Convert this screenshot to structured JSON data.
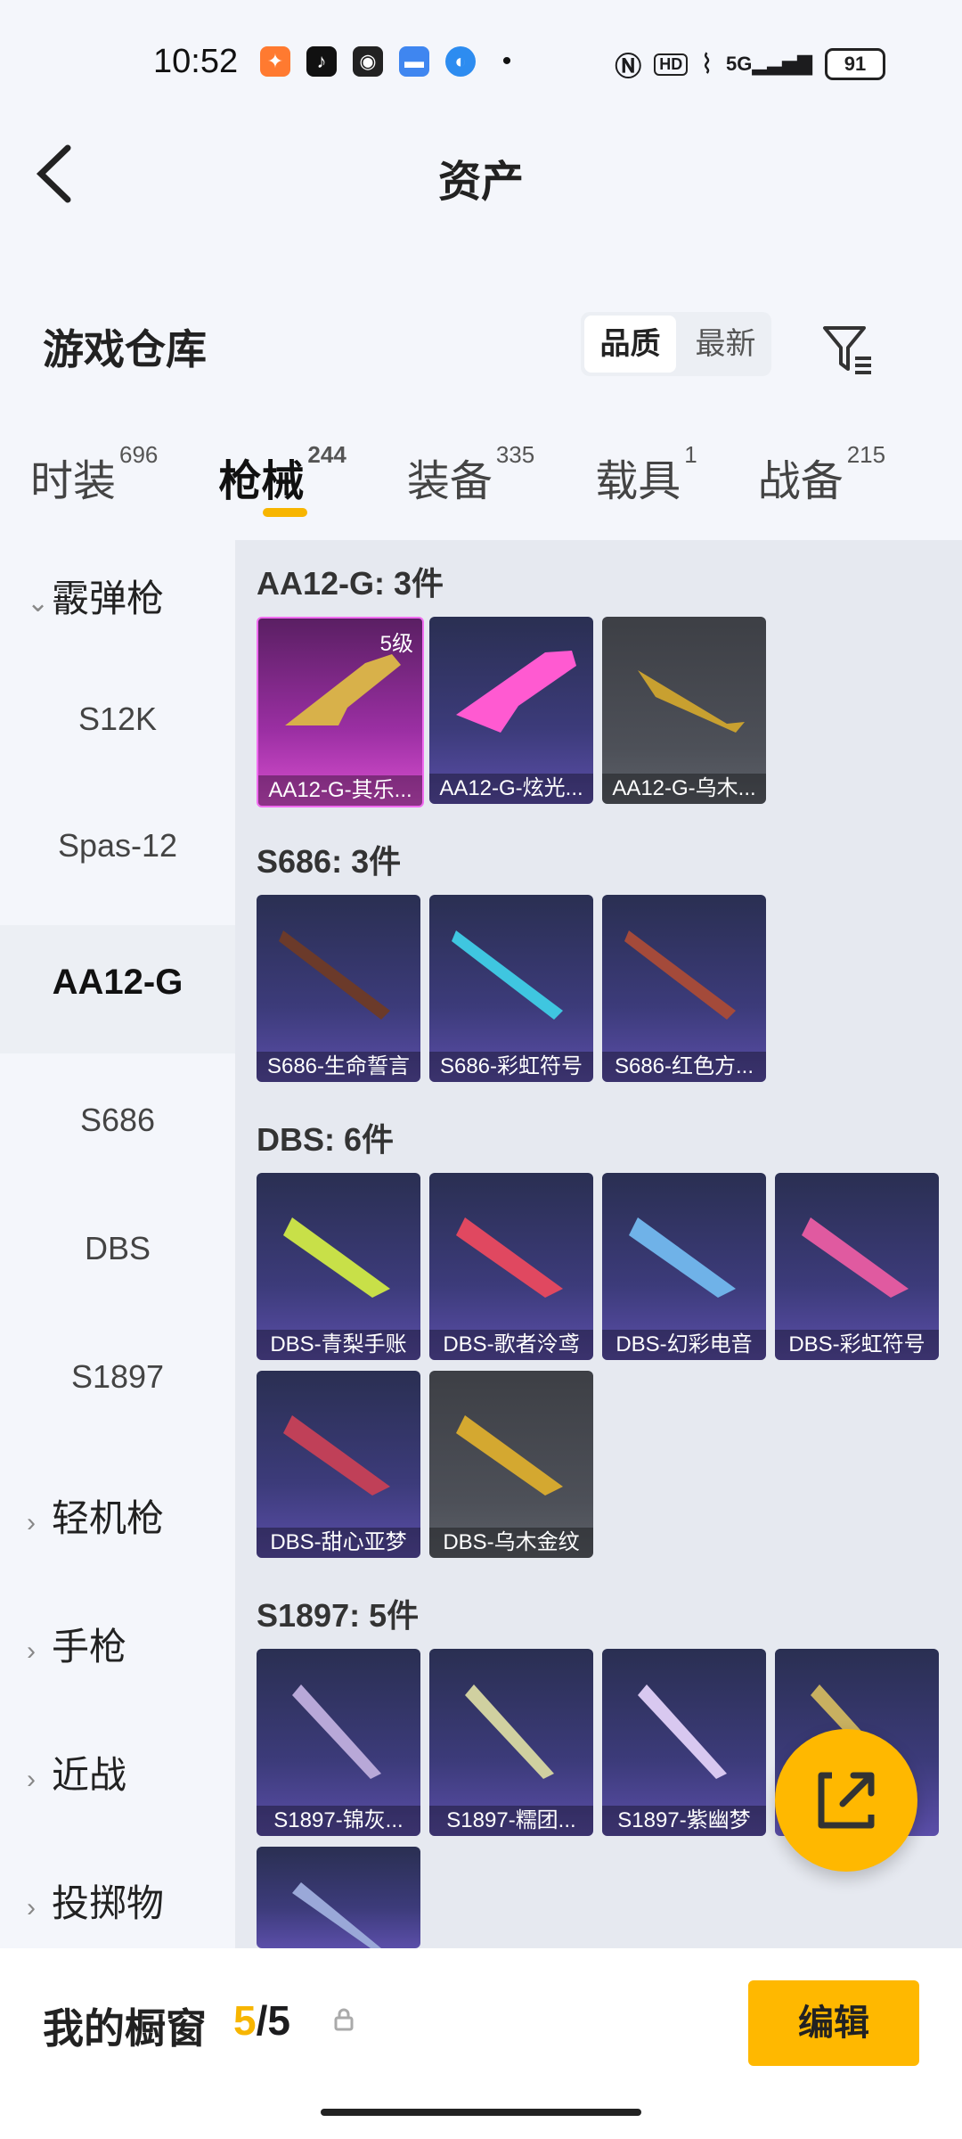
{
  "status_bar": {
    "time": "10:52",
    "app_icons": [
      "game-icon",
      "tiktok-icon",
      "wechat-icon",
      "wallet-icon",
      "browser-icon",
      "dot-icon"
    ],
    "right_icons": [
      "nfc-icon",
      "hd-icon",
      "wifi-icon",
      "5g-signal-icon"
    ],
    "hd_label": "HD",
    "network_label": "5G",
    "battery": "91"
  },
  "header": {
    "title": "资产"
  },
  "warehouse": {
    "title": "游戏仓库",
    "sort_options": [
      "品质",
      "最新"
    ]
  },
  "tabs": [
    {
      "label": "时装",
      "count": "696"
    },
    {
      "label": "枪械",
      "count": "244"
    },
    {
      "label": "装备",
      "count": "335"
    },
    {
      "label": "载具",
      "count": "1"
    },
    {
      "label": "战备",
      "count": "215"
    }
  ],
  "sidebar": {
    "cat_shotgun": "霰弹枪",
    "subs": [
      "S12K",
      "Spas-12",
      "AA12-G",
      "S686",
      "DBS",
      "S1897"
    ],
    "cat_lmg": "轻机枪",
    "cat_pistol": "手枪",
    "cat_melee": "近战",
    "cat_throw": "投掷物"
  },
  "groups": {
    "aa12": {
      "title": "AA12-G: 3件",
      "items": [
        "AA12-G-其乐...",
        "AA12-G-炫光...",
        "AA12-G-乌木..."
      ],
      "level": "5级"
    },
    "s686": {
      "title": "S686: 3件",
      "items": [
        "S686-生命誓言",
        "S686-彩虹符号",
        "S686-红色方..."
      ]
    },
    "dbs": {
      "title": "DBS: 6件",
      "items": [
        "DBS-青梨手账",
        "DBS-歌者泠鸢",
        "DBS-幻彩电音",
        "DBS-彩虹符号",
        "DBS-甜心亚梦",
        "DBS-乌木金纹"
      ]
    },
    "s1897": {
      "title": "S1897: 5件",
      "items": [
        "S1897-锦灰...",
        "S1897-糯团...",
        "S1897-紫幽梦"
      ]
    }
  },
  "bottom": {
    "title": "我的橱窗",
    "count_current": "5",
    "count_sep": "/",
    "count_total": "5",
    "edit_label": "编辑"
  }
}
